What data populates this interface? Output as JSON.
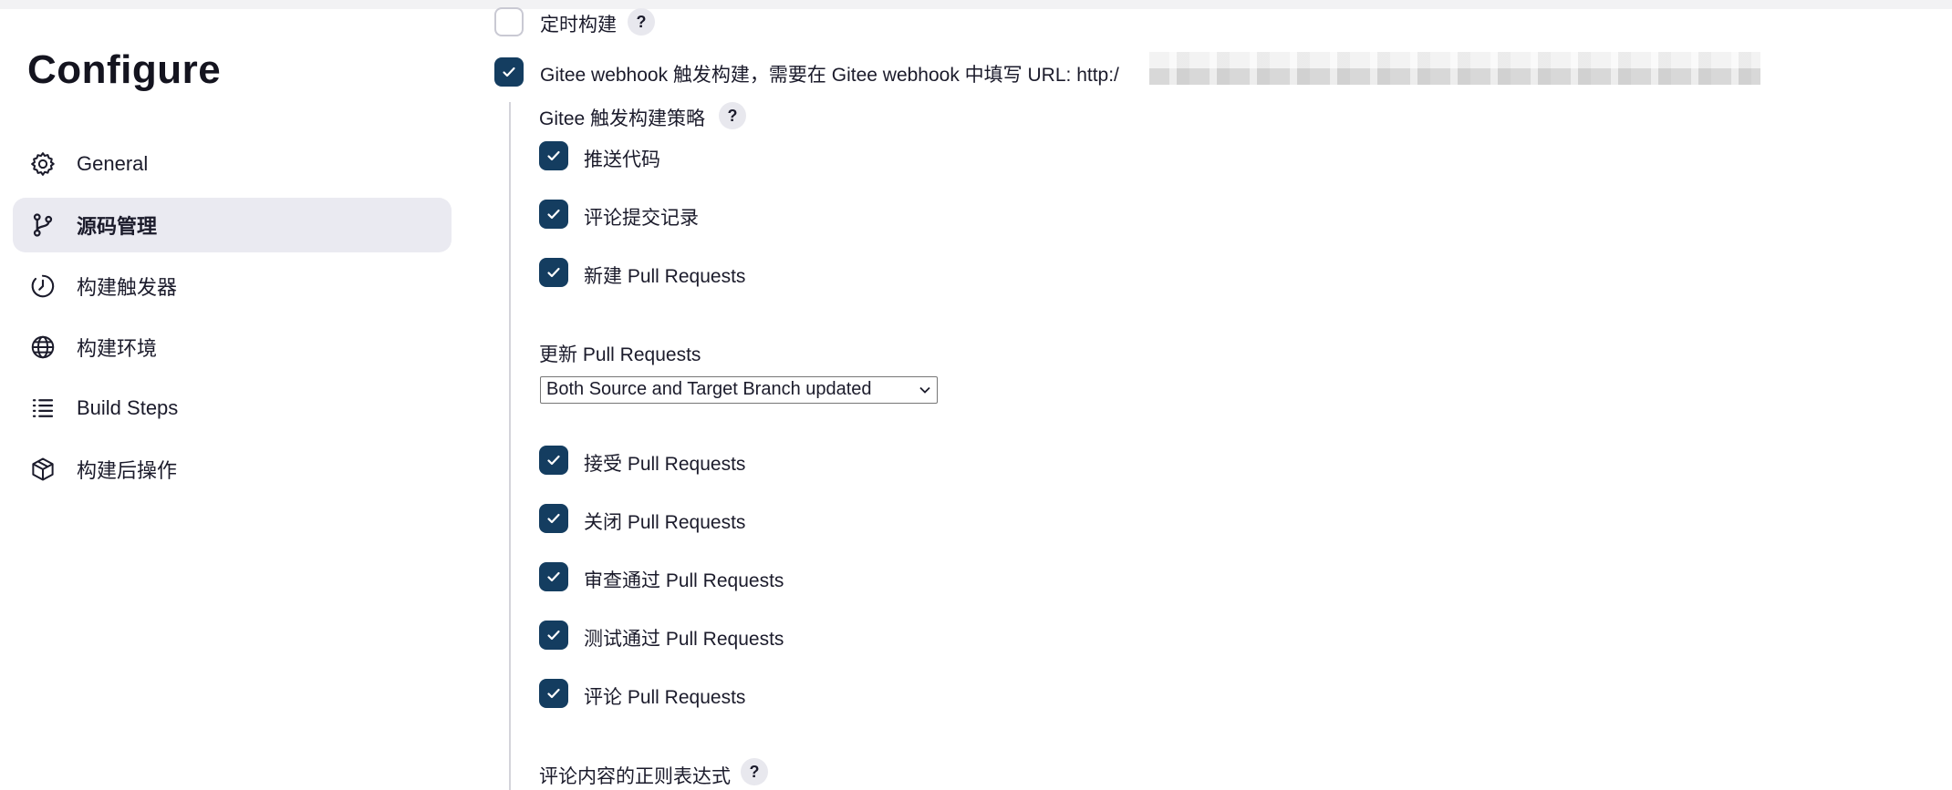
{
  "page": {
    "title": "Configure"
  },
  "sidebar": {
    "items": [
      {
        "label": "General",
        "icon": "gear-icon",
        "active": false
      },
      {
        "label": "源码管理",
        "icon": "branch-icon",
        "active": true
      },
      {
        "label": "构建触发器",
        "icon": "clock-icon",
        "active": false
      },
      {
        "label": "构建环境",
        "icon": "globe-icon",
        "active": false
      },
      {
        "label": "Build Steps",
        "icon": "list-icon",
        "active": false
      },
      {
        "label": "构建后操作",
        "icon": "package-icon",
        "active": false
      }
    ]
  },
  "triggers": {
    "scheduled": {
      "label": "定时构建",
      "checked": false
    },
    "gitee_webhook": {
      "label": "Gitee webhook 触发构建，需要在 Gitee webhook 中填写 URL: http:/",
      "checked": true
    },
    "strategy_title": "Gitee 触发构建策略",
    "strategy_options": [
      {
        "label": "推送代码",
        "checked": true
      },
      {
        "label": "评论提交记录",
        "checked": true
      },
      {
        "label": "新建 Pull Requests",
        "checked": true
      }
    ],
    "update_pr": {
      "label": "更新 Pull Requests",
      "selected": "Both Source and Target Branch updated"
    },
    "pr_options": [
      {
        "label": "接受 Pull Requests",
        "checked": true
      },
      {
        "label": "关闭 Pull Requests",
        "checked": true
      },
      {
        "label": "审查通过 Pull Requests",
        "checked": true
      },
      {
        "label": "测试通过 Pull Requests",
        "checked": true
      },
      {
        "label": "评论 Pull Requests",
        "checked": true
      }
    ],
    "comment_regex_label": "评论内容的正则表达式",
    "help_label": "?"
  },
  "colors": {
    "checkbox_checked": "#143d60",
    "active_nav_bg": "#eaeaf1"
  }
}
